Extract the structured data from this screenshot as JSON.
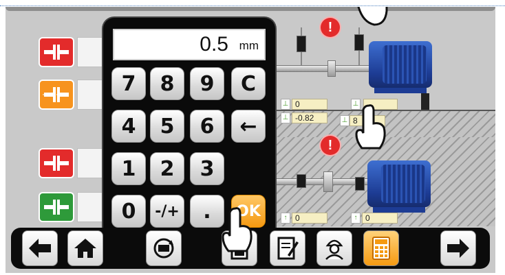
{
  "keypad": {
    "display_value": "0.5",
    "display_unit": "mm",
    "keys": [
      "7",
      "8",
      "9",
      "C",
      "4",
      "5",
      "6",
      "←",
      "1",
      "2",
      "3",
      "0",
      "-/+",
      ".",
      "OK"
    ]
  },
  "measurements": {
    "top_vertical": "0",
    "top_horizontal": "-0.82",
    "top_right_horizontal": "8",
    "bottom_left": "0",
    "bottom_right": "0"
  },
  "toolbar": {
    "back": "back-arrow",
    "home": "home",
    "rotate": "rotate-machine",
    "report": "report",
    "notes": "notes",
    "operator": "operator",
    "calculator": "calculator",
    "next": "next-arrow"
  },
  "colors": {
    "coupling_red": "#e32b2b",
    "coupling_orange": "#f7931e",
    "coupling_green": "#2e9a3a",
    "motor_blue": "#2a55c0",
    "ok_orange": "#f59a12"
  }
}
